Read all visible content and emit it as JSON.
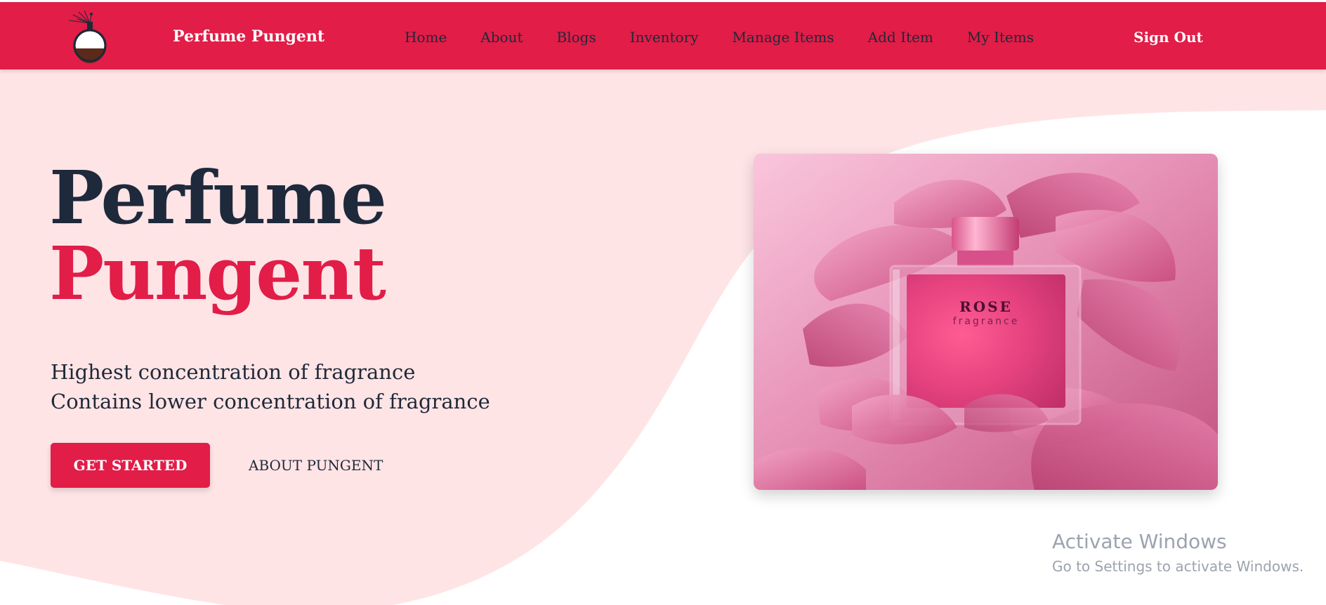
{
  "header": {
    "brand": "Perfume Pungent",
    "nav": [
      {
        "label": "Home"
      },
      {
        "label": "About"
      },
      {
        "label": "Blogs"
      },
      {
        "label": "Inventory"
      },
      {
        "label": "Manage Items"
      },
      {
        "label": "Add Item"
      },
      {
        "label": "My Items"
      }
    ],
    "sign_out": "Sign Out"
  },
  "hero": {
    "title_line1": "Perfume",
    "title_line2": "Pungent",
    "subtitle_line1": "Highest concentration of fragrance",
    "subtitle_line2": "Contains lower concentration of fragrance",
    "cta_primary": "GET STARTED",
    "cta_secondary": "ABOUT PUNGENT"
  },
  "product_image": {
    "bottle_label": "ROSE",
    "bottle_sublabel": "fragrance"
  },
  "watermark": {
    "line1": "Activate Windows",
    "line2": "Go to Settings to activate Windows."
  },
  "colors": {
    "accent": "#e11d48",
    "hero_bg": "#ffe4e6",
    "dark_text": "#1e293b"
  },
  "icons": {
    "logo": "perfume-bottle-icon"
  }
}
